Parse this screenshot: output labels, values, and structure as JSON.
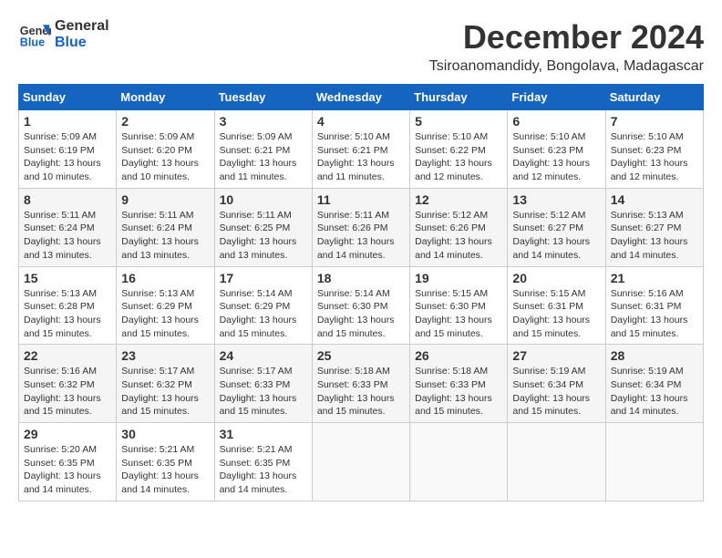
{
  "header": {
    "logo_line1": "General",
    "logo_line2": "Blue",
    "month": "December 2024",
    "location": "Tsiroanomandidy, Bongolava, Madagascar"
  },
  "weekdays": [
    "Sunday",
    "Monday",
    "Tuesday",
    "Wednesday",
    "Thursday",
    "Friday",
    "Saturday"
  ],
  "weeks": [
    [
      {
        "day": "1",
        "sunrise": "5:09 AM",
        "sunset": "6:19 PM",
        "daylight": "13 hours and 10 minutes."
      },
      {
        "day": "2",
        "sunrise": "5:09 AM",
        "sunset": "6:20 PM",
        "daylight": "13 hours and 10 minutes."
      },
      {
        "day": "3",
        "sunrise": "5:09 AM",
        "sunset": "6:21 PM",
        "daylight": "13 hours and 11 minutes."
      },
      {
        "day": "4",
        "sunrise": "5:10 AM",
        "sunset": "6:21 PM",
        "daylight": "13 hours and 11 minutes."
      },
      {
        "day": "5",
        "sunrise": "5:10 AM",
        "sunset": "6:22 PM",
        "daylight": "13 hours and 12 minutes."
      },
      {
        "day": "6",
        "sunrise": "5:10 AM",
        "sunset": "6:23 PM",
        "daylight": "13 hours and 12 minutes."
      },
      {
        "day": "7",
        "sunrise": "5:10 AM",
        "sunset": "6:23 PM",
        "daylight": "13 hours and 12 minutes."
      }
    ],
    [
      {
        "day": "8",
        "sunrise": "5:11 AM",
        "sunset": "6:24 PM",
        "daylight": "13 hours and 13 minutes."
      },
      {
        "day": "9",
        "sunrise": "5:11 AM",
        "sunset": "6:24 PM",
        "daylight": "13 hours and 13 minutes."
      },
      {
        "day": "10",
        "sunrise": "5:11 AM",
        "sunset": "6:25 PM",
        "daylight": "13 hours and 13 minutes."
      },
      {
        "day": "11",
        "sunrise": "5:11 AM",
        "sunset": "6:26 PM",
        "daylight": "13 hours and 14 minutes."
      },
      {
        "day": "12",
        "sunrise": "5:12 AM",
        "sunset": "6:26 PM",
        "daylight": "13 hours and 14 minutes."
      },
      {
        "day": "13",
        "sunrise": "5:12 AM",
        "sunset": "6:27 PM",
        "daylight": "13 hours and 14 minutes."
      },
      {
        "day": "14",
        "sunrise": "5:13 AM",
        "sunset": "6:27 PM",
        "daylight": "13 hours and 14 minutes."
      }
    ],
    [
      {
        "day": "15",
        "sunrise": "5:13 AM",
        "sunset": "6:28 PM",
        "daylight": "13 hours and 15 minutes."
      },
      {
        "day": "16",
        "sunrise": "5:13 AM",
        "sunset": "6:29 PM",
        "daylight": "13 hours and 15 minutes."
      },
      {
        "day": "17",
        "sunrise": "5:14 AM",
        "sunset": "6:29 PM",
        "daylight": "13 hours and 15 minutes."
      },
      {
        "day": "18",
        "sunrise": "5:14 AM",
        "sunset": "6:30 PM",
        "daylight": "13 hours and 15 minutes."
      },
      {
        "day": "19",
        "sunrise": "5:15 AM",
        "sunset": "6:30 PM",
        "daylight": "13 hours and 15 minutes."
      },
      {
        "day": "20",
        "sunrise": "5:15 AM",
        "sunset": "6:31 PM",
        "daylight": "13 hours and 15 minutes."
      },
      {
        "day": "21",
        "sunrise": "5:16 AM",
        "sunset": "6:31 PM",
        "daylight": "13 hours and 15 minutes."
      }
    ],
    [
      {
        "day": "22",
        "sunrise": "5:16 AM",
        "sunset": "6:32 PM",
        "daylight": "13 hours and 15 minutes."
      },
      {
        "day": "23",
        "sunrise": "5:17 AM",
        "sunset": "6:32 PM",
        "daylight": "13 hours and 15 minutes."
      },
      {
        "day": "24",
        "sunrise": "5:17 AM",
        "sunset": "6:33 PM",
        "daylight": "13 hours and 15 minutes."
      },
      {
        "day": "25",
        "sunrise": "5:18 AM",
        "sunset": "6:33 PM",
        "daylight": "13 hours and 15 minutes."
      },
      {
        "day": "26",
        "sunrise": "5:18 AM",
        "sunset": "6:33 PM",
        "daylight": "13 hours and 15 minutes."
      },
      {
        "day": "27",
        "sunrise": "5:19 AM",
        "sunset": "6:34 PM",
        "daylight": "13 hours and 15 minutes."
      },
      {
        "day": "28",
        "sunrise": "5:19 AM",
        "sunset": "6:34 PM",
        "daylight": "13 hours and 14 minutes."
      }
    ],
    [
      {
        "day": "29",
        "sunrise": "5:20 AM",
        "sunset": "6:35 PM",
        "daylight": "13 hours and 14 minutes."
      },
      {
        "day": "30",
        "sunrise": "5:21 AM",
        "sunset": "6:35 PM",
        "daylight": "13 hours and 14 minutes."
      },
      {
        "day": "31",
        "sunrise": "5:21 AM",
        "sunset": "6:35 PM",
        "daylight": "13 hours and 14 minutes."
      },
      null,
      null,
      null,
      null
    ]
  ]
}
